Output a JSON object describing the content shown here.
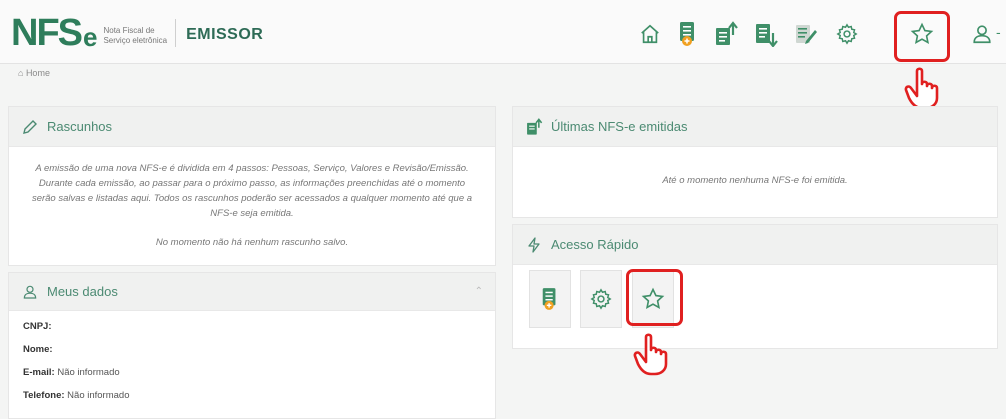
{
  "header": {
    "logo_mark": "NFS",
    "logo_e": "e",
    "logo_sub_line1": "Nota Fiscal de",
    "logo_sub_line2": "Serviço eletrônica",
    "app_name": "EMISSOR"
  },
  "nav": {
    "items": [
      {
        "icon": "home-icon"
      },
      {
        "icon": "new-invoice-icon"
      },
      {
        "icon": "upload-document-icon"
      },
      {
        "icon": "download-document-icon"
      },
      {
        "icon": "edit-document-icon"
      },
      {
        "icon": "gear-icon"
      },
      {
        "icon": "star-icon"
      },
      {
        "icon": "user-icon"
      }
    ],
    "user_caret": "-"
  },
  "breadcrumb": {
    "home": "Home"
  },
  "rascunhos": {
    "title": "Rascunhos",
    "description": "A emissão de uma nova NFS-e é dividida em 4 passos: Pessoas, Serviço, Valores e Revisão/Emissão. Durante cada emissão, ao passar para o próximo passo, as informações preenchidas até o momento serão salvas e listadas aqui. Todos os rascunhos poderão ser acessados a qualquer momento até que a NFS-e seja emitida.",
    "empty": "No momento não há nenhum rascunho salvo."
  },
  "meus_dados": {
    "title": "Meus dados",
    "fields": [
      {
        "label": "CNPJ:",
        "value": ""
      },
      {
        "label": "Nome:",
        "value": ""
      },
      {
        "label": "E-mail:",
        "value": "Não informado"
      },
      {
        "label": "Telefone:",
        "value": "Não informado"
      }
    ]
  },
  "ultimas": {
    "title": "Últimas NFS-e emitidas",
    "empty": "Até o momento nenhuma NFS-e foi emitida."
  },
  "acesso_rapido": {
    "title": "Acesso Rápido",
    "items": [
      {
        "icon": "new-invoice-icon"
      },
      {
        "icon": "gear-icon"
      },
      {
        "icon": "star-icon"
      }
    ]
  },
  "colors": {
    "accent": "#2e7d5b",
    "highlight": "#e02020",
    "icon_green": "#3f8f68",
    "icon_orange": "#f0a020"
  }
}
